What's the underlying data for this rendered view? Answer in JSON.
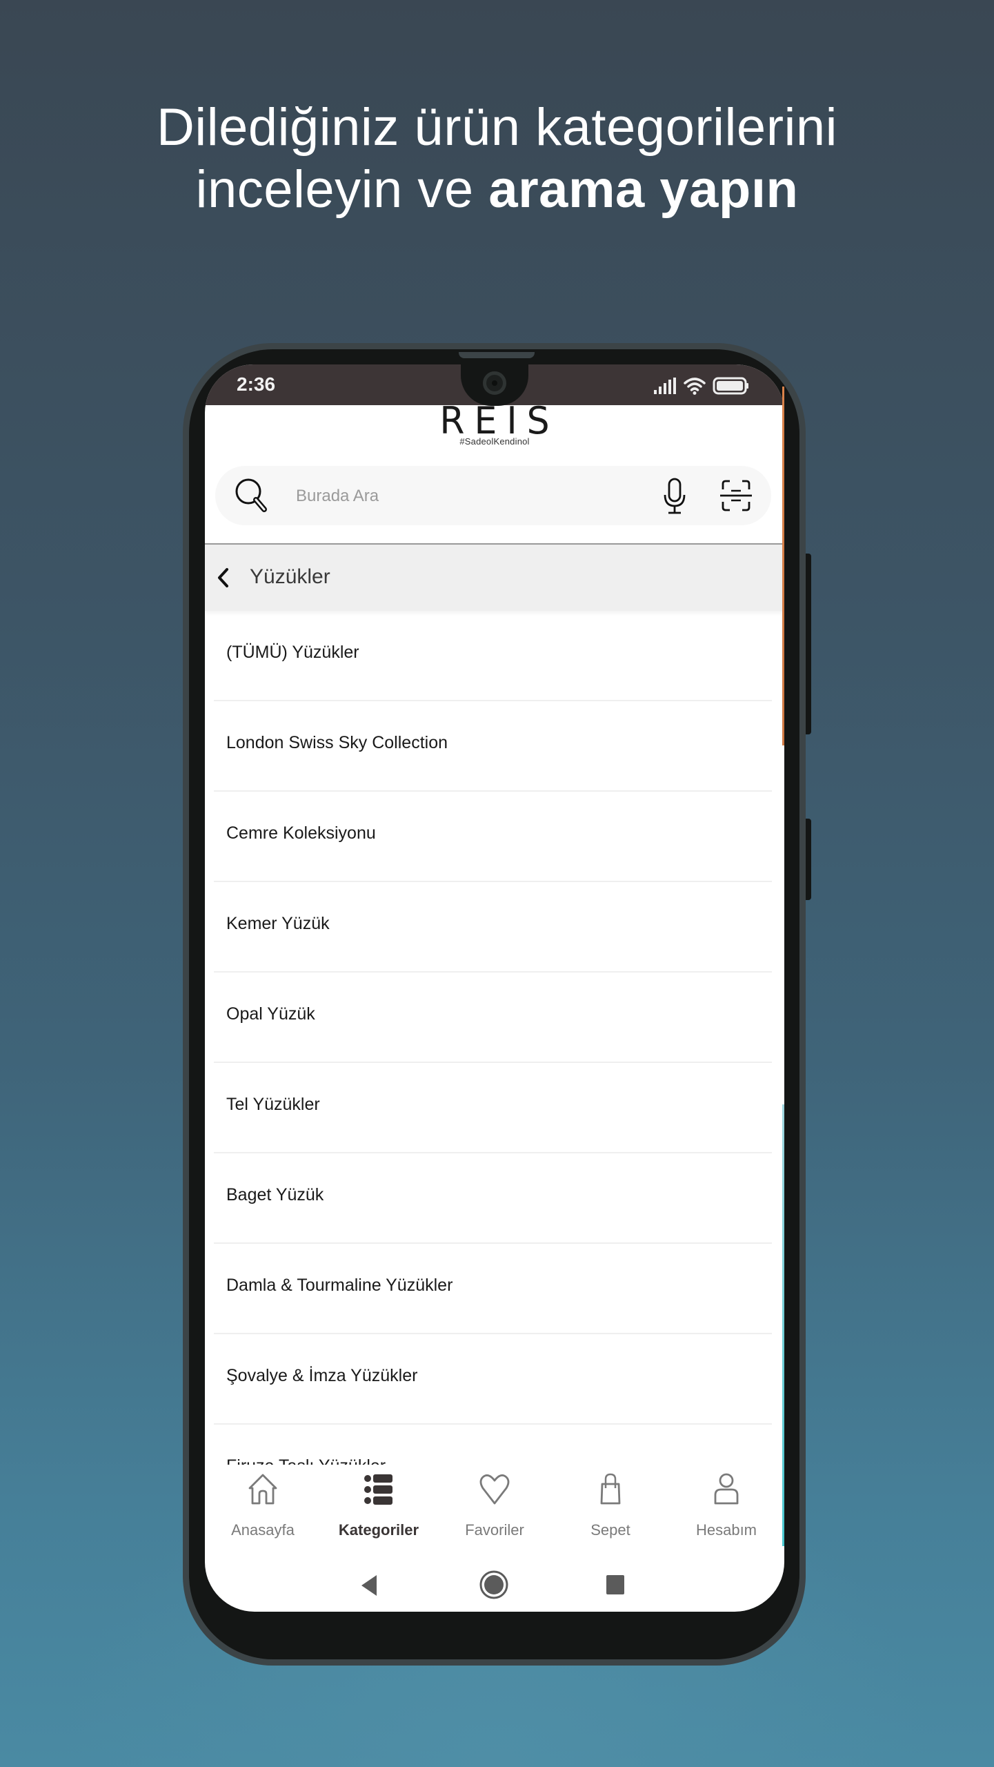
{
  "headline": {
    "line1": "Dilediğiniz ürün kategorilerini",
    "line2_regular": "inceleyin ve ",
    "line2_bold": "arama yapın"
  },
  "status_bar": {
    "time": "2:36",
    "icons": [
      "signal-icon",
      "wifi-icon",
      "battery-icon"
    ]
  },
  "app": {
    "logo": "REIS",
    "tagline": "#SadeolKendinol"
  },
  "search": {
    "placeholder": "Burada Ara",
    "value": "",
    "icons": [
      "search-icon",
      "microphone-icon",
      "scan-icon"
    ]
  },
  "category_header": {
    "title": "Yüzükler",
    "back_icon": "chevron-left-icon"
  },
  "categories": [
    {
      "label": "(TÜMÜ) Yüzükler"
    },
    {
      "label": "London Swiss Sky Collection"
    },
    {
      "label": "Cemre Koleksiyonu"
    },
    {
      "label": "Kemer Yüzük"
    },
    {
      "label": "Opal Yüzük"
    },
    {
      "label": "Tel Yüzükler"
    },
    {
      "label": "Baget Yüzük"
    },
    {
      "label": "Damla & Tourmaline Yüzükler"
    },
    {
      "label": "Şovalye & İmza Yüzükler"
    },
    {
      "label": "Firuze Taşlı Yüzükler"
    }
  ],
  "bottom_nav": {
    "active": "Kategoriler",
    "items": [
      {
        "label": "Anasayfa",
        "icon": "home-icon"
      },
      {
        "label": "Kategoriler",
        "icon": "list-icon"
      },
      {
        "label": "Favoriler",
        "icon": "heart-icon"
      },
      {
        "label": "Sepet",
        "icon": "shopping-bag-icon"
      },
      {
        "label": "Hesabım",
        "icon": "user-icon"
      }
    ]
  },
  "system_nav": [
    "back-triangle-icon",
    "home-circle-icon",
    "recents-square-icon"
  ],
  "colors": {
    "status_bar": "#3d3536",
    "category_header_bg": "#efefef",
    "search_bg": "#f7f7f7",
    "active_nav": "#3a3535",
    "inactive_nav": "#7a7a7a"
  }
}
